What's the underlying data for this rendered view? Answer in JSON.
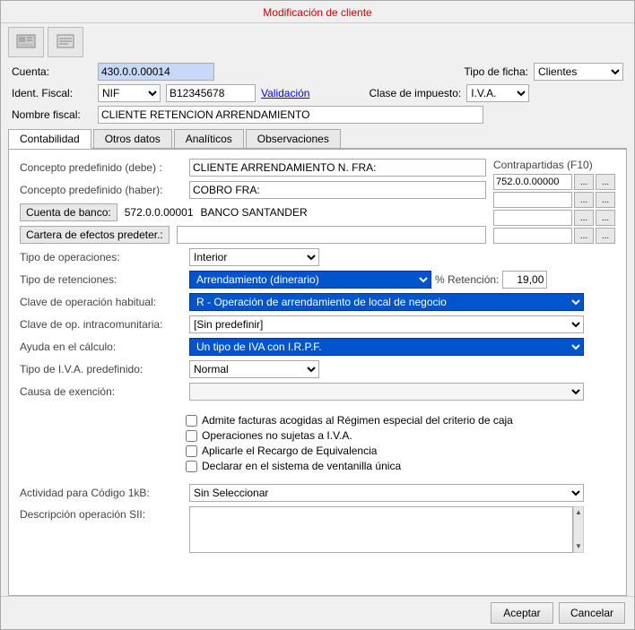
{
  "window": {
    "title": "Modificación de cliente"
  },
  "header": {
    "cuenta_label": "Cuenta:",
    "cuenta_value": "430.0.0.00014",
    "tipo_ficha_label": "Tipo de ficha:",
    "tipo_ficha_value": "Clientes",
    "ident_fiscal_label": "Ident. Fiscal:",
    "ident_fiscal_type": "NIF",
    "ident_fiscal_value": "B12345678",
    "validacion_label": "Validación",
    "clase_impuesto_label": "Clase de impuesto:",
    "clase_impuesto_value": "I.V.A.",
    "nombre_fiscal_label": "Nombre fiscal:",
    "nombre_fiscal_value": "CLIENTE RETENCION ARRENDAMIENTO"
  },
  "tabs": [
    {
      "label": "Contabilidad",
      "active": true
    },
    {
      "label": "Otros datos",
      "active": false
    },
    {
      "label": "Analíticos",
      "active": false
    },
    {
      "label": "Observaciones",
      "active": false
    }
  ],
  "contabilidad": {
    "concepto_debe_label": "Concepto predefinido (debe) :",
    "concepto_debe_value": "CLIENTE ARRENDAMIENTO N. FRA:",
    "concepto_haber_label": "Concepto predefinido (haber):",
    "concepto_haber_value": "COBRO FRA:",
    "cuenta_banco_label": "Cuenta de banco:",
    "cuenta_banco_num": "572.0.0.00001",
    "cuenta_banco_name": "BANCO SANTANDER",
    "cartera_label": "Cartera de efectos predeter.:",
    "contrapartidas_title": "Contrapartidas (F10)",
    "contrapartidas": [
      {
        "value": "752.0.0.00000"
      },
      {
        "value": ""
      },
      {
        "value": ""
      },
      {
        "value": ""
      }
    ],
    "tipo_operaciones_label": "Tipo de operaciones:",
    "tipo_operaciones_value": "Interior",
    "tipo_retenciones_label": "Tipo de retenciones:",
    "tipo_retenciones_value": "Arrendamiento (dinerario)",
    "retencion_label": "% Retención:",
    "retencion_value": "19,00",
    "clave_habitual_label": "Clave de operación habitual:",
    "clave_habitual_value": "R - Operación de arrendamiento de local de negocio",
    "clave_intracomunitaria_label": "Clave de op. intracomunitaria:",
    "clave_intracomunitaria_value": "[Sin predefinir]",
    "ayuda_calculo_label": "Ayuda en el cálculo:",
    "ayuda_calculo_value": "Un tipo de IVA con I.R.P.F.",
    "tipo_iva_label": "Tipo de I.V.A. predefinido:",
    "tipo_iva_value": "Normal",
    "causa_exencion_label": "Causa de exención:",
    "causa_exencion_value": "",
    "checkboxes": [
      {
        "label": "Admite facturas acogidas al Régimen especial del criterio de caja",
        "checked": false
      },
      {
        "label": "Operaciones no sujetas a I.V.A.",
        "checked": false
      },
      {
        "label": "Aplicarle el Recargo de Equivalencia",
        "checked": false
      },
      {
        "label": "Declarar en el sistema de ventanilla única",
        "checked": false
      }
    ],
    "actividad_label": "Actividad para Código 1kB:",
    "actividad_value": "Sin Seleccionar",
    "descripcion_label": "Descripción operación SII:"
  },
  "buttons": {
    "aceptar": "Aceptar",
    "cancelar": "Cancelar"
  }
}
